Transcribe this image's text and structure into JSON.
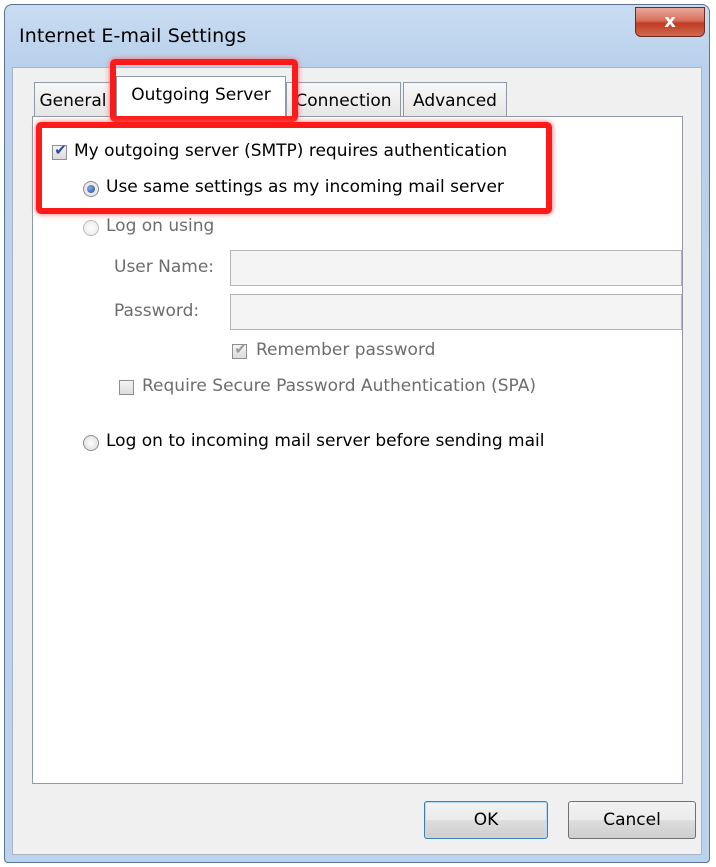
{
  "window": {
    "title": "Internet E-mail Settings",
    "close_glyph": "x"
  },
  "tabs": [
    {
      "label": "General"
    },
    {
      "label": "Outgoing Server"
    },
    {
      "label": "Connection"
    },
    {
      "label": "Advanced"
    }
  ],
  "auth": {
    "requires_auth_label": "My outgoing server (SMTP) requires authentication",
    "requires_auth_checked": true,
    "use_same_label": "Use same settings as my incoming mail server",
    "use_same_selected": true,
    "log_on_using_label": "Log on using",
    "user_name_label": "User Name:",
    "user_name_value": "",
    "password_label": "Password:",
    "password_value": "",
    "remember_password_label": "Remember password",
    "remember_password_checked": true,
    "spa_label": "Require Secure Password Authentication (SPA)",
    "spa_checked": false,
    "log_on_incoming_label": "Log on to incoming mail server before sending mail"
  },
  "buttons": {
    "ok": "OK",
    "cancel": "Cancel"
  },
  "colors": {
    "highlight": "#ff1a1a",
    "accent": "#2b4f9c"
  }
}
